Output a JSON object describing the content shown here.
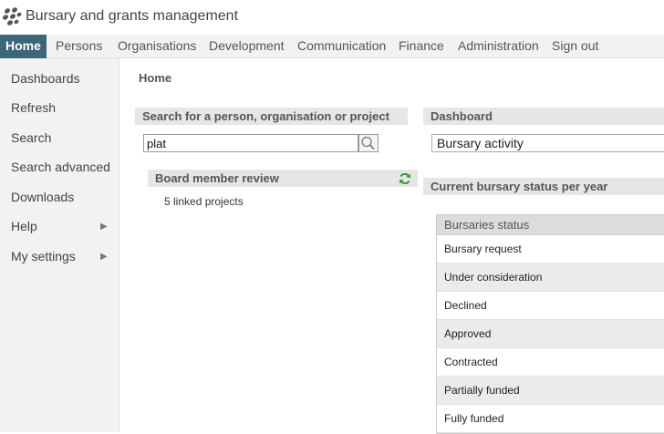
{
  "header": {
    "title": "Bursary and grants management",
    "logo_icon": "paw-cluster-logo"
  },
  "nav": {
    "items": [
      {
        "label": "Home",
        "active": true
      },
      {
        "label": "Persons"
      },
      {
        "label": "Organisations"
      },
      {
        "label": "Development"
      },
      {
        "label": "Communication"
      },
      {
        "label": "Finance"
      },
      {
        "label": "Administration"
      },
      {
        "label": "Sign out"
      }
    ],
    "active_color": "#3b6778"
  },
  "sidebar": {
    "items": [
      {
        "label": "Dashboards"
      },
      {
        "label": "Refresh"
      },
      {
        "label": "Search"
      },
      {
        "label": "Search advanced"
      },
      {
        "label": "Downloads"
      },
      {
        "label": "Help",
        "has_submenu": true
      },
      {
        "label": "My settings",
        "has_submenu": true
      }
    ]
  },
  "breadcrumb": "Home",
  "search": {
    "header": "Search for a person, organisation or project",
    "value": "plat",
    "button_icon": "magnifier-icon"
  },
  "board_review": {
    "header": "Board member review",
    "refresh_icon": "refresh-icon",
    "linked_text": "5 linked projects"
  },
  "dashboard": {
    "header": "Dashboard",
    "selected": "Bursary activity"
  },
  "bursary_status": {
    "header": "Current bursary status per year",
    "table_header": "Bursaries status",
    "rows": [
      "Bursary request",
      "Under consideration",
      "Declined",
      "Approved",
      "Contracted",
      "Partially funded",
      "Fully funded"
    ]
  }
}
